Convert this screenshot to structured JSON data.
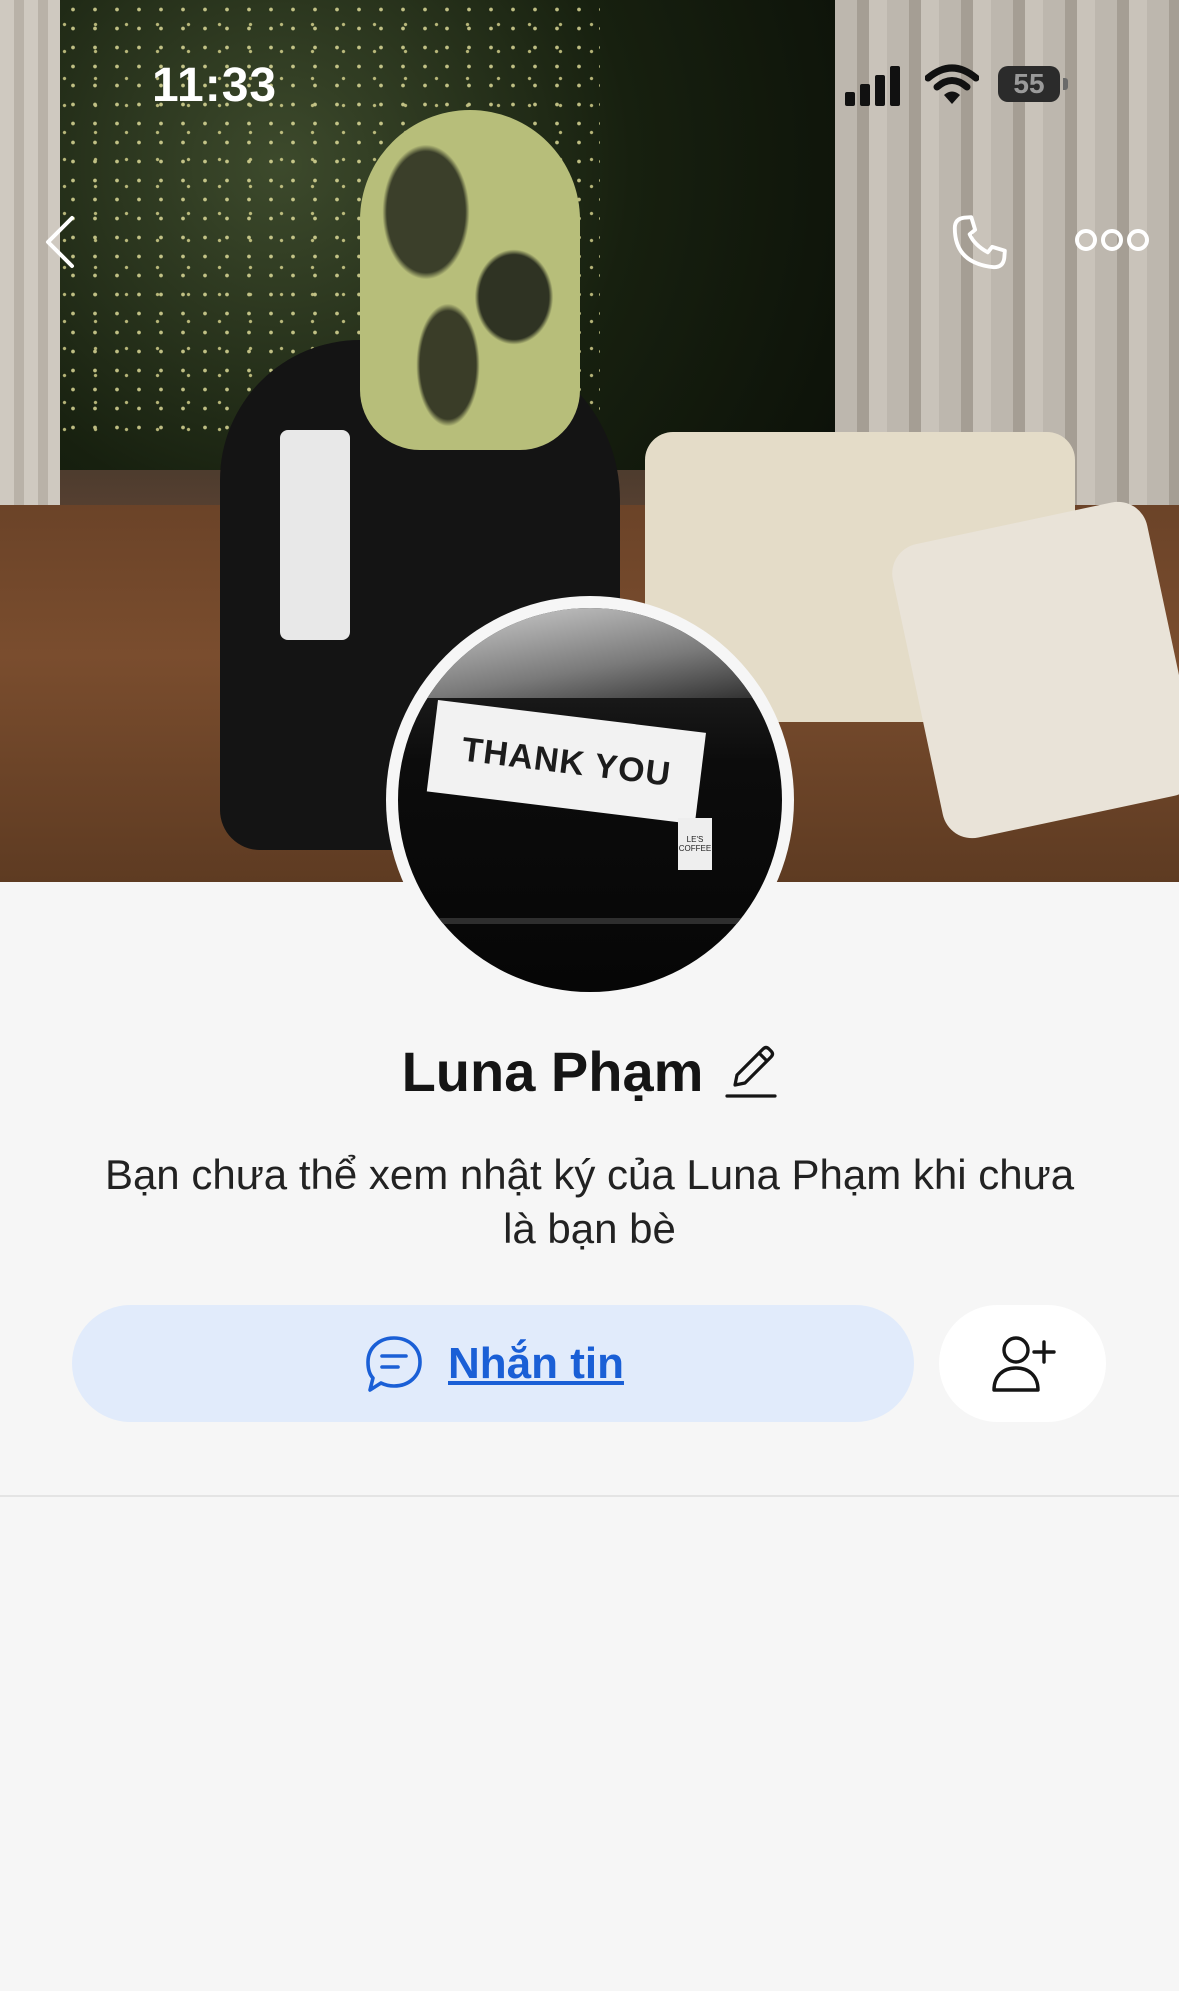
{
  "status_bar": {
    "time": "11:33",
    "battery": "55"
  },
  "header": {
    "back_icon": "chevron-left-icon",
    "call_icon": "phone-icon",
    "more_icon": "more-horizontal-icon"
  },
  "avatar": {
    "sign_text": "THANK YOU",
    "small_sign_text": "LE'S COFFEE"
  },
  "profile": {
    "name": "Luna Phạm",
    "edit_icon": "pencil-icon",
    "notice": "Bạn chưa thể xem nhật ký của Luna Phạm khi chưa là bạn bè"
  },
  "actions": {
    "message_label": "Nhắn tin",
    "message_icon": "chat-bubble-icon",
    "add_friend_icon": "add-user-icon"
  },
  "colors": {
    "accent": "#1a5fd6",
    "message_button_bg": "#e1ebfb",
    "page_bg": "#f6f6f6"
  }
}
